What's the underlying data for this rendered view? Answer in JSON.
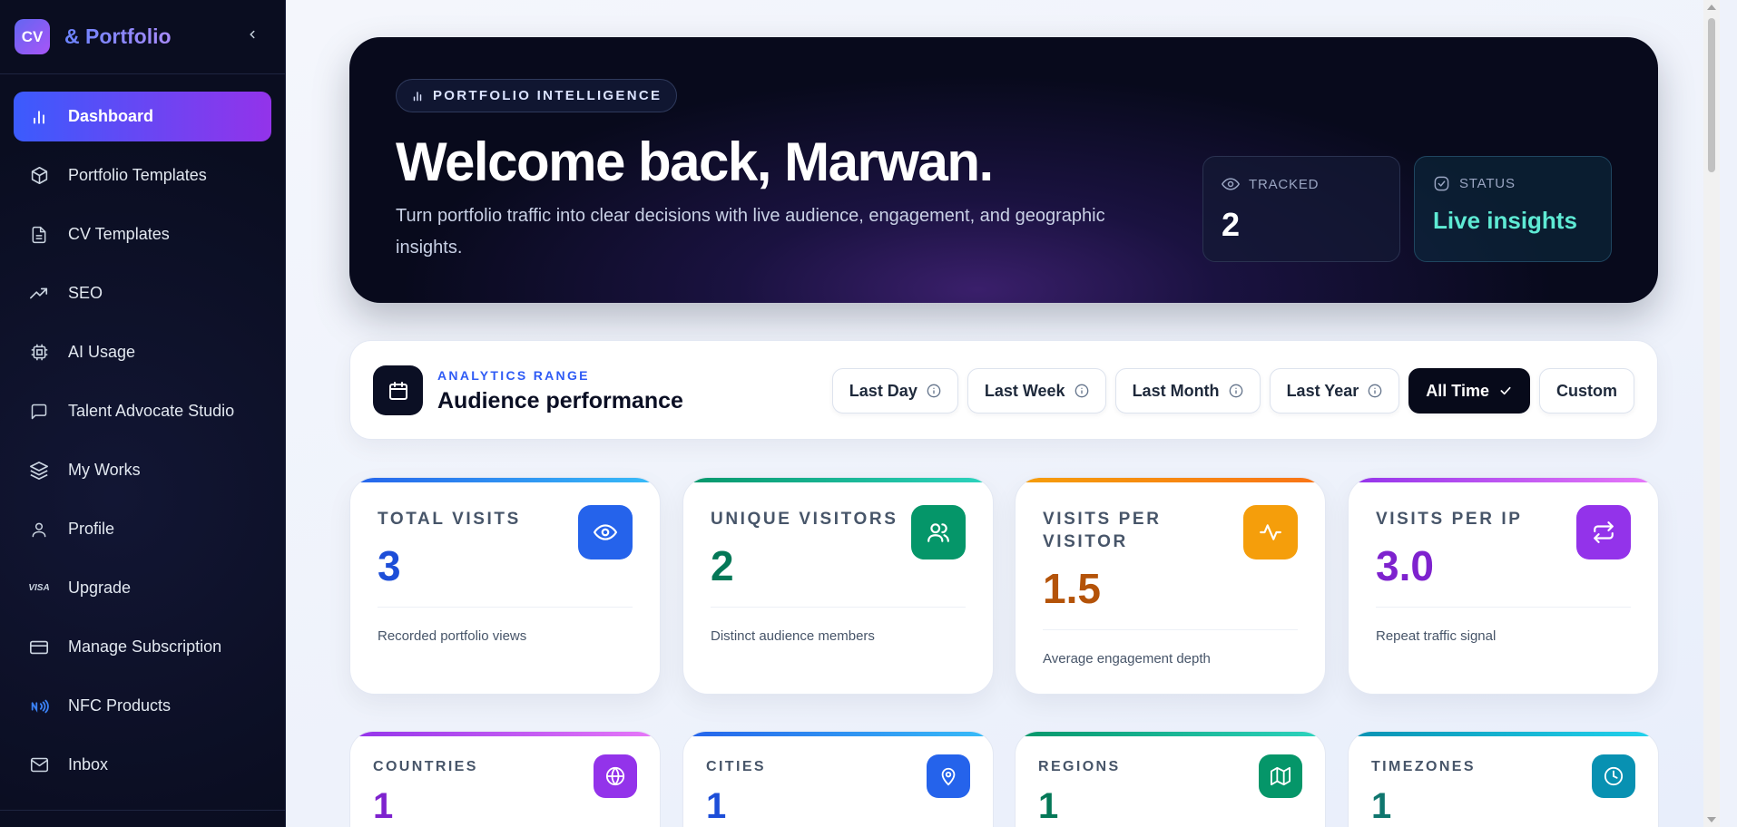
{
  "brand": {
    "logo": "CV",
    "name": "& Portfolio"
  },
  "sidebar": {
    "items": [
      {
        "label": "Dashboard",
        "icon": "bar-chart-icon",
        "active": true
      },
      {
        "label": "Portfolio Templates",
        "icon": "box-icon"
      },
      {
        "label": "CV Templates",
        "icon": "file-text-icon"
      },
      {
        "label": "SEO",
        "icon": "trending-up-icon"
      },
      {
        "label": "AI Usage",
        "icon": "cpu-icon"
      },
      {
        "label": "Talent Advocate Studio",
        "icon": "message-square-icon"
      },
      {
        "label": "My Works",
        "icon": "layers-icon"
      },
      {
        "label": "Profile",
        "icon": "user-icon"
      },
      {
        "label": "Upgrade",
        "icon": "visa-icon",
        "icon_text": "VISA"
      },
      {
        "label": "Manage Subscription",
        "icon": "credit-card-icon"
      },
      {
        "label": "NFC Products",
        "icon": "nfc-icon"
      },
      {
        "label": "Inbox",
        "icon": "mail-icon"
      }
    ]
  },
  "hero": {
    "badge": "PORTFOLIO INTELLIGENCE",
    "title": "Welcome back, Marwan.",
    "subtitle": "Turn portfolio traffic into clear decisions with live audience, engagement, and geographic insights.",
    "tracked": {
      "label": "TRACKED",
      "value": "2"
    },
    "status": {
      "label": "STATUS",
      "value": "Live insights"
    }
  },
  "range": {
    "kicker": "ANALYTICS RANGE",
    "title": "Audience performance",
    "buttons": [
      {
        "label": "Last Day",
        "info": true
      },
      {
        "label": "Last Week",
        "info": true
      },
      {
        "label": "Last Month",
        "info": true
      },
      {
        "label": "Last Year",
        "info": true
      },
      {
        "label": "All Time",
        "active": true
      },
      {
        "label": "Custom"
      }
    ]
  },
  "metrics": [
    {
      "label": "TOTAL VISITS",
      "value": "3",
      "desc": "Recorded portfolio views",
      "icon": "eye-icon",
      "color": "#1d4ed8",
      "icon_bg": "#2563eb",
      "bar": "linear-gradient(90deg,#2563eb,#38bdf8)"
    },
    {
      "label": "UNIQUE VISITORS",
      "value": "2",
      "desc": "Distinct audience members",
      "icon": "users-icon",
      "color": "#047857",
      "icon_bg": "#059669",
      "bar": "linear-gradient(90deg,#059669,#2dd4bf)"
    },
    {
      "label": "VISITS PER VISITOR",
      "value": "1.5",
      "desc": "Average engagement depth",
      "icon": "activity-icon",
      "color": "#b45309",
      "icon_bg": "#f59e0b",
      "bar": "linear-gradient(90deg,#f59e0b,#f97316)"
    },
    {
      "label": "VISITS PER IP",
      "value": "3.0",
      "desc": "Repeat traffic signal",
      "icon": "repeat-icon",
      "color": "#7e22ce",
      "icon_bg": "#9333ea",
      "bar": "linear-gradient(90deg,#9333ea,#e879f9)"
    }
  ],
  "geo": [
    {
      "label": "COUNTRIES",
      "value": "1",
      "icon": "globe-icon",
      "color": "#7e22ce",
      "icon_bg": "#9333ea",
      "bar": "linear-gradient(90deg,#9333ea,#e879f9)"
    },
    {
      "label": "CITIES",
      "value": "1",
      "icon": "map-pin-icon",
      "color": "#1d4ed8",
      "icon_bg": "#2563eb",
      "bar": "linear-gradient(90deg,#2563eb,#38bdf8)"
    },
    {
      "label": "REGIONS",
      "value": "1",
      "icon": "map-icon",
      "color": "#047857",
      "icon_bg": "#059669",
      "bar": "linear-gradient(90deg,#059669,#2dd4bf)"
    },
    {
      "label": "TIMEZONES",
      "value": "1",
      "icon": "clock-icon",
      "color": "#0f766e",
      "icon_bg": "#0891b2",
      "bar": "linear-gradient(90deg,#0891b2,#22d3ee)"
    }
  ]
}
